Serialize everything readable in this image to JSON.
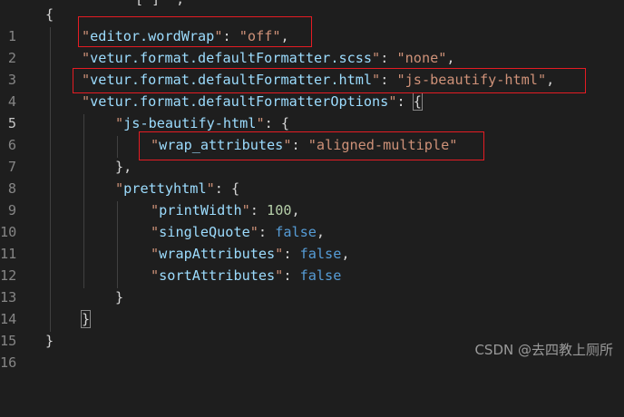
{
  "top_fragment": "\"[ ]\" ;",
  "line_numbers": [
    "1",
    "2",
    "3",
    "4",
    "5",
    "6",
    "7",
    "8",
    "9",
    "10",
    "11",
    "12",
    "13",
    "14",
    "15",
    "16"
  ],
  "lines": {
    "l1_brace": "{",
    "l2_key": "editor.wordWrap",
    "l2_val": "off",
    "l3_key": "vetur.format.defaultFormatter.scss",
    "l3_val": "none",
    "l4_key": "vetur.format.defaultFormatter.html",
    "l4_val": "js-beautify-html",
    "l5_key": "vetur.format.defaultFormatterOptions",
    "l5_brace": "{",
    "l6_key": "js-beautify-html",
    "l6_brace": "{",
    "l7_key": "wrap_attributes",
    "l7_val": "aligned-multiple",
    "l8_close": "},",
    "l9_key": "prettyhtml",
    "l9_brace": "{",
    "l10_key": "printWidth",
    "l10_val": "100",
    "l11_key": "singleQuote",
    "l11_val": "false",
    "l12_key": "wrapAttributes",
    "l12_val": "false",
    "l13_key": "sortAttributes",
    "l13_val": "false",
    "l14_close": "}",
    "l15_close": "}",
    "l16_close": "}"
  },
  "watermark": "CSDN @去四教上厕所",
  "colors": {
    "background": "#1e1e1e",
    "key": "#9cdcfe",
    "string": "#ce9178",
    "number": "#b5cea8",
    "boolean": "#569cd6",
    "highlight_box": "#e51c23"
  }
}
